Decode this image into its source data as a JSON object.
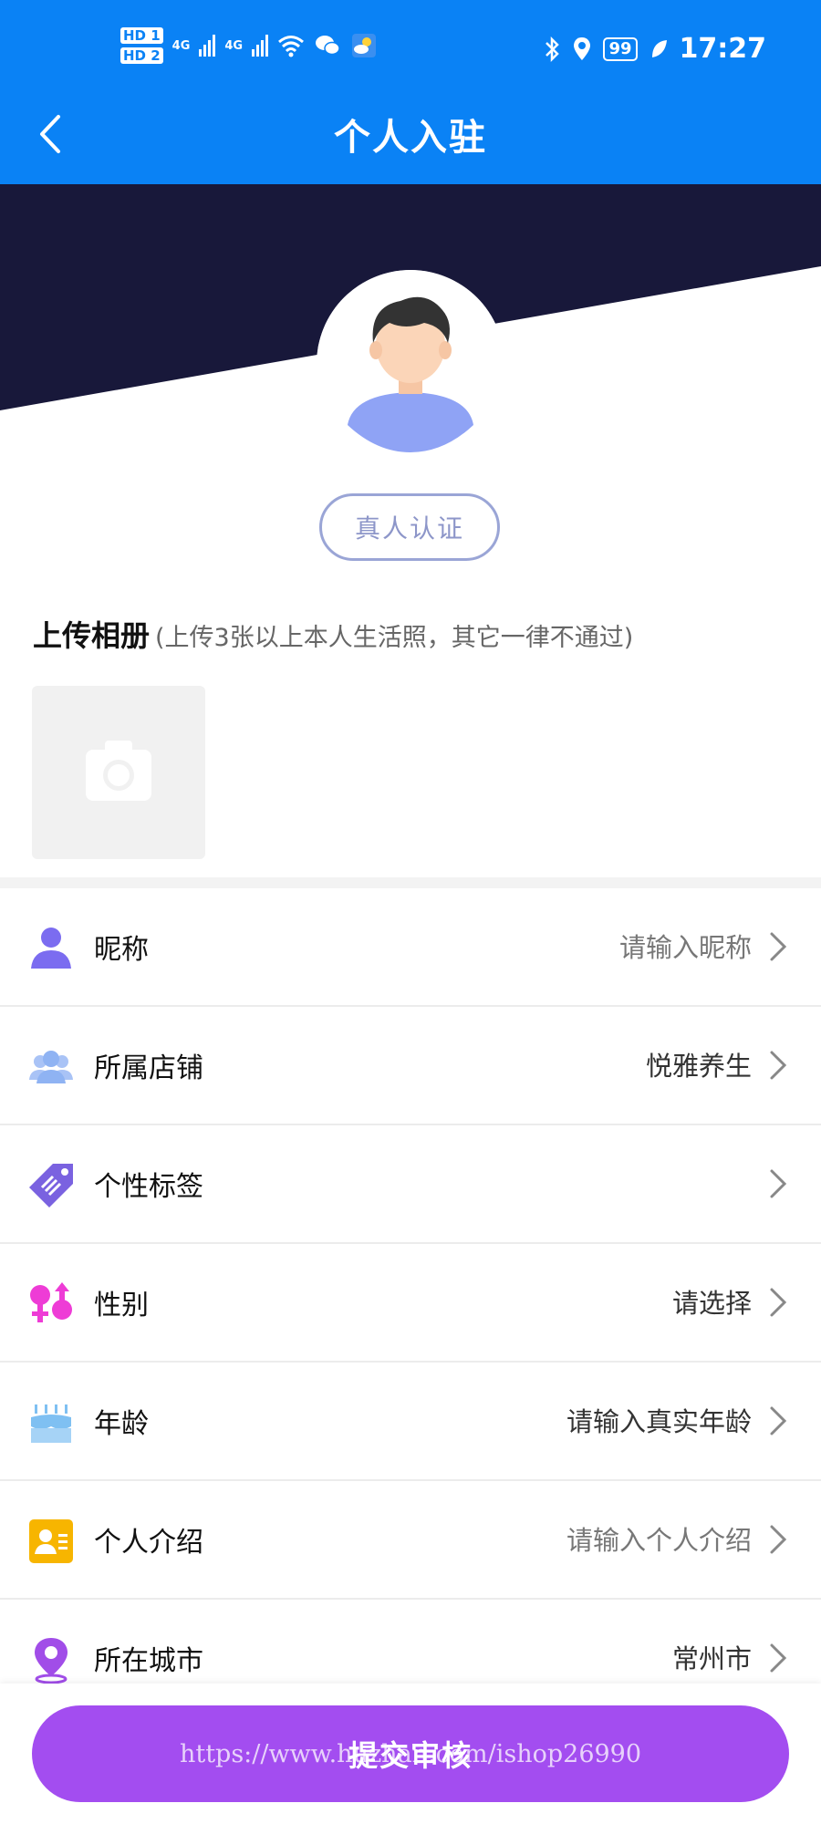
{
  "status_bar": {
    "hd1": "HD 1",
    "hd2": "HD 2",
    "net1": "4G",
    "net2": "4G",
    "battery": "99",
    "time": "17:27",
    "icons": [
      "wifi-icon",
      "wechat-icon",
      "weather-icon",
      "bluetooth-icon",
      "location-icon",
      "leaf-icon"
    ]
  },
  "header": {
    "title": "个人入驻",
    "bg_color": "#0a82f5"
  },
  "hero": {
    "dark_color": "#18183a",
    "verify_label": "真人认证"
  },
  "album": {
    "title": "上传相册",
    "hint": "(上传3张以上本人生活照，其它一律不通过)"
  },
  "fields": [
    {
      "label": "昵称",
      "value": "请输入昵称",
      "icon": "user-icon",
      "icon_color": "#7b6cf0",
      "filled": false
    },
    {
      "label": "所属店铺",
      "value": "悦雅养生",
      "icon": "group-icon",
      "icon_color": "#8fb3f3",
      "filled": true
    },
    {
      "label": "个性标签",
      "value": "",
      "icon": "tag-icon",
      "icon_color": "#7a62e0",
      "filled": false
    },
    {
      "label": "性别",
      "value": "请选择",
      "icon": "gender-icon",
      "icon_color": "#ee3cd6",
      "filled": true
    },
    {
      "label": "年龄",
      "value": "请输入真实年龄",
      "icon": "cake-icon",
      "icon_color": "#7fc0f2",
      "filled": true
    },
    {
      "label": "个人介绍",
      "value": "请输入个人介绍",
      "icon": "profile-card-icon",
      "icon_color": "#f7b500",
      "filled": false
    },
    {
      "label": "所在城市",
      "value": "常州市",
      "icon": "location-pin-icon",
      "icon_color": "#a14de8",
      "filled": true
    }
  ],
  "submit": {
    "label": "提交审核",
    "color": "#a34df0"
  },
  "watermark": "https://www.huzhan.com/ishop26990"
}
